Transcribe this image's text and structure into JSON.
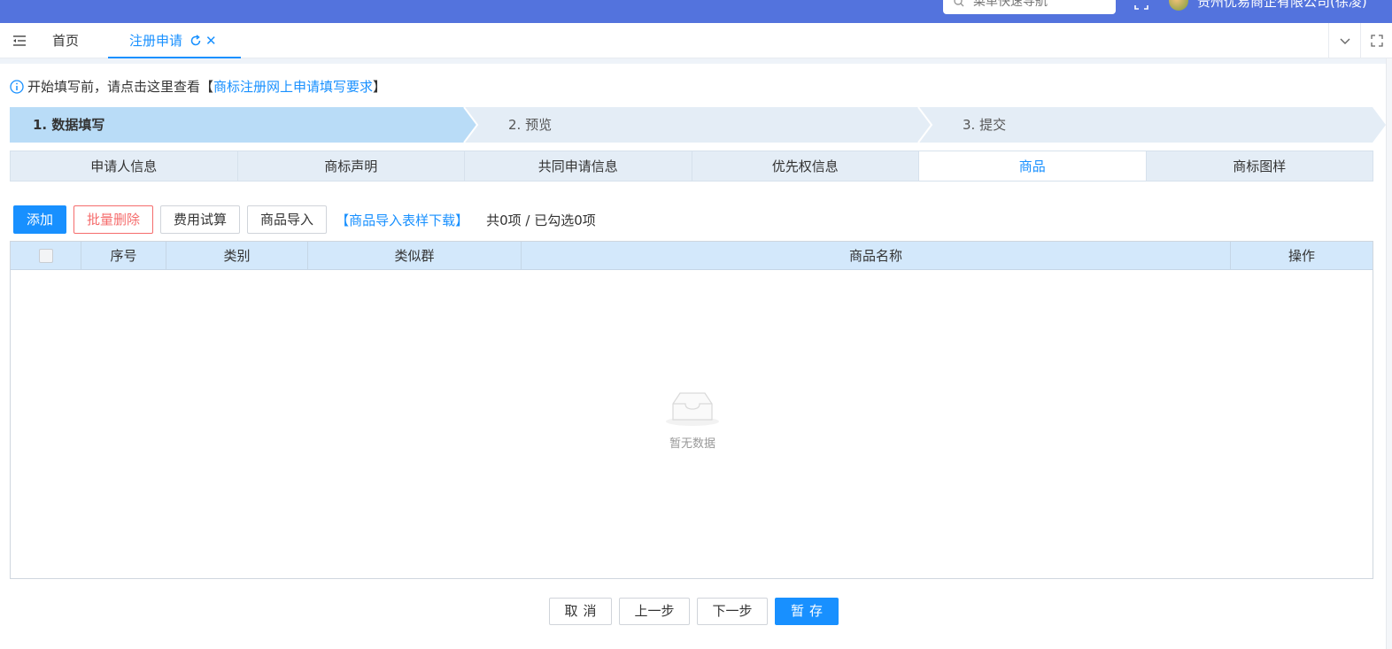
{
  "header": {
    "search_placeholder": "菜单快速导航",
    "company": "贵州优易商企有限公司(徐凌)",
    "colors": {
      "bar": "#5373dd"
    }
  },
  "tabs": {
    "home": "首页",
    "active": "注册申请"
  },
  "notice": {
    "prefix": "开始填写前，请点击这里查看【",
    "link": "商标注册网上申请填写要求",
    "suffix": "】"
  },
  "steps": [
    {
      "label": "1. 数据填写",
      "active": true
    },
    {
      "label": "2. 预览",
      "active": false
    },
    {
      "label": "3. 提交",
      "active": false
    }
  ],
  "section_tabs": [
    {
      "label": "申请人信息",
      "active": false
    },
    {
      "label": "商标声明",
      "active": false
    },
    {
      "label": "共同申请信息",
      "active": false
    },
    {
      "label": "优先权信息",
      "active": false
    },
    {
      "label": "商品",
      "active": true
    },
    {
      "label": "商标图样",
      "active": false
    }
  ],
  "toolbar": {
    "add": "添加",
    "batch_delete": "批量删除",
    "fee_calc": "费用试算",
    "import": "商品导入",
    "template_link": "【商品导入表样下载】",
    "count": "共0项 / 已勾选0项"
  },
  "table": {
    "columns": [
      "序号",
      "类别",
      "类似群",
      "商品名称",
      "操作"
    ],
    "rows": [],
    "empty_text": "暂无数据"
  },
  "footer": {
    "cancel": "取消",
    "prev": "上一步",
    "next": "下一步",
    "save": "暂存"
  },
  "colors": {
    "primary": "#1890ff",
    "danger": "#f56c6c",
    "step_active": "#b9dcf7",
    "step_inactive": "#e4edf6"
  }
}
